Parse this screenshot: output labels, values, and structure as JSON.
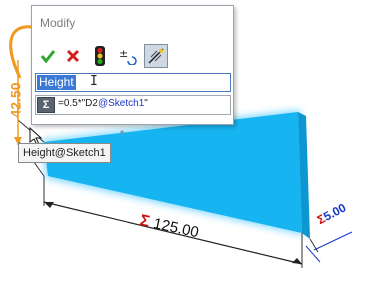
{
  "dialog": {
    "title": "Modify",
    "toolbar": [
      {
        "name": "ok-button",
        "icon": "checkmark-icon"
      },
      {
        "name": "cancel-button",
        "icon": "x-icon"
      },
      {
        "name": "rebuild-button",
        "icon": "traffic-light-icon"
      },
      {
        "name": "reverse-sense-button",
        "icon": "plus-minus-icon"
      },
      {
        "name": "mark-dimension-button",
        "icon": "dimension-mark-icon"
      }
    ],
    "name_field_value": "Height",
    "equation_symbol": "Σ",
    "equation_prefix": "=0.5*\"D2",
    "equation_link": "@Sketch1",
    "equation_suffix": "\""
  },
  "tooltip": "Height@Sketch1",
  "dimensions": {
    "vertical": "42.50",
    "horizontal": "125.00",
    "depth": "5.00",
    "sigma": "Σ"
  },
  "colors": {
    "plate": "#16b4f0",
    "dimension_red": "#cc1010",
    "dimension_blue": "#1a35c8",
    "accent_orange": "#f09a20",
    "selection": "#3b79d6"
  }
}
